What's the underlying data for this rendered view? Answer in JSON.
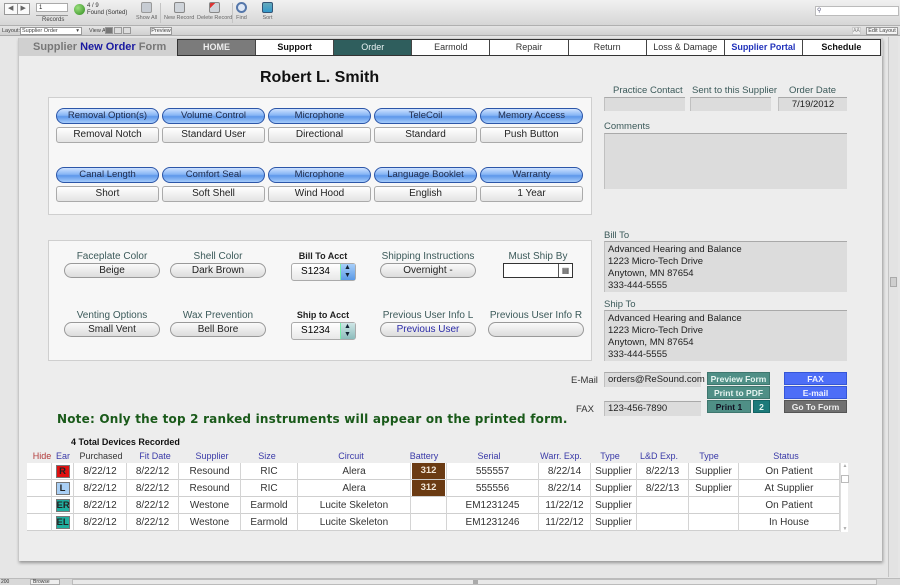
{
  "toolbar": {
    "record_number": "1",
    "records_label": "Records",
    "found_count": "4 / 9",
    "found_status": "Found (Sorted)",
    "buttons": {
      "show_all": "Show All",
      "new_record": "New Record",
      "delete_record": "Delete Record",
      "find": "Find",
      "sort": "Sort"
    },
    "search_placeholder": ""
  },
  "layoutbar": {
    "layout_label": "Layout:",
    "layout_value": "Supplier Order",
    "view_as_label": "View As:",
    "preview_label": "Preview",
    "aa_label": "AÄ",
    "edit_layout_label": "Edit Layout"
  },
  "form": {
    "title_part1": "Supplier ",
    "title_part2": "New Order",
    "title_part3": " Form",
    "nav_tabs": [
      "HOME",
      "Support",
      "Order",
      "Earmold",
      "Repair",
      "Return",
      "Loss & Damage",
      "Supplier Portal",
      "Schedule"
    ],
    "patient_name": "Robert L. Smith",
    "options": [
      {
        "label": "Removal Option(s)",
        "value": "Removal Notch"
      },
      {
        "label": "Volume Control",
        "value": "Standard User"
      },
      {
        "label": "Microphone",
        "value": "Directional"
      },
      {
        "label": "TeleCoil",
        "value": "Standard"
      },
      {
        "label": "Memory Access",
        "value": "Push Button"
      },
      {
        "label": "Canal Length",
        "value": "Short"
      },
      {
        "label": "Comfort Seal",
        "value": "Soft Shell"
      },
      {
        "label": "Microphone",
        "value": "Wind Hood"
      },
      {
        "label": "Language Booklet",
        "value": "English"
      },
      {
        "label": "Warranty",
        "value": "1 Year"
      }
    ],
    "details": {
      "faceplate_color": {
        "label": "Faceplate Color",
        "value": "Beige"
      },
      "shell_color": {
        "label": "Shell Color",
        "value": "Dark Brown"
      },
      "bill_to_acct": {
        "label": "Bill To Acct",
        "value": "S1234"
      },
      "shipping_instructions": {
        "label": "Shipping Instructions",
        "value": "Overnight -"
      },
      "must_ship_by": {
        "label": "Must Ship By",
        "value": ""
      },
      "venting_options": {
        "label": "Venting Options",
        "value": "Small Vent"
      },
      "wax_prevention": {
        "label": "Wax Prevention",
        "value": "Bell Bore"
      },
      "ship_to_acct": {
        "label": "Ship to Acct",
        "value": "S1234"
      },
      "prev_user_l": {
        "label": "Previous User Info L",
        "value": "Previous User"
      },
      "prev_user_r": {
        "label": "Previous User Info R",
        "value": ""
      }
    },
    "right": {
      "practice_contact_label": "Practice Contact",
      "practice_contact_value": "",
      "sent_supplier_label": "Sent to this Supplier",
      "sent_supplier_value": "",
      "order_date_label": "Order Date",
      "order_date_value": "7/19/2012",
      "comments_label": "Comments",
      "comments_value": "",
      "bill_to_label": "Bill To",
      "bill_to_value": "Advanced Hearing and Balance\n1223 Micro-Tech Drive\nAnytown, MN 87654\n333-444-5555",
      "ship_to_label": "Ship To",
      "ship_to_value": "Advanced Hearing and Balance\n1223 Micro-Tech Drive\nAnytown, MN 87654\n333-444-5555",
      "email_label": "E-Mail",
      "email_value": "orders@ReSound.com",
      "fax_label": "FAX",
      "fax_value": "123-456-7890"
    },
    "actions": {
      "preview_form": "Preview Form",
      "print_pdf": "Print to PDF",
      "print_1": "Print 1",
      "print_2": "2",
      "fax": "FAX",
      "email": "E-mail",
      "go_to_form": "Go To Form"
    },
    "note": "Note: Only the top 2 ranked instruments will appear on the printed form.",
    "total_devices": "4 Total Devices Recorded",
    "colors": {
      "accent_blue": "#4d6ef7",
      "teal": "#2f5e5d",
      "battery_brown": "#6b3b13",
      "note_green": "#1a5a1a"
    }
  },
  "devices": {
    "columns": [
      "Hide",
      "Ear",
      "Purchased",
      "Fit Date",
      "Supplier",
      "Size",
      "Circuit",
      "Battery",
      "Serial",
      "Warr. Exp.",
      "Type",
      "L&D  Exp.",
      "Type",
      "Status"
    ],
    "rows": [
      {
        "ear": "R",
        "ear_color": "#e01010",
        "purchased": "8/22/12",
        "fit": "8/22/12",
        "supplier": "Resound",
        "size": "RIC",
        "circuit": "Alera",
        "battery": "312",
        "serial": "555557",
        "warr": "8/22/14",
        "type": "Supplier",
        "ld": "8/22/13",
        "type2": "Supplier",
        "status": "On Patient"
      },
      {
        "ear": "L",
        "ear_color": "#a9cff5",
        "purchased": "8/22/12",
        "fit": "8/22/12",
        "supplier": "Resound",
        "size": "RIC",
        "circuit": "Alera",
        "battery": "312",
        "serial": "555556",
        "warr": "8/22/14",
        "type": "Supplier",
        "ld": "8/22/13",
        "type2": "Supplier",
        "status": "At Supplier"
      },
      {
        "ear": "ER",
        "ear_color": "#1fae9f",
        "purchased": "8/22/12",
        "fit": "8/22/12",
        "supplier": "Westone",
        "size": "Earmold",
        "circuit": "Lucite Skeleton",
        "battery": "",
        "serial": "EM1231245",
        "warr": "11/22/12",
        "type": "Supplier",
        "ld": "",
        "type2": "",
        "status": "On Patient"
      },
      {
        "ear": "EL",
        "ear_color": "#1fae9f",
        "purchased": "8/22/12",
        "fit": "8/22/12",
        "supplier": "Westone",
        "size": "Earmold",
        "circuit": "Lucite Skeleton",
        "battery": "",
        "serial": "EM1231246",
        "warr": "11/22/12",
        "type": "Supplier",
        "ld": "",
        "type2": "",
        "status": "In House"
      }
    ]
  },
  "statusbar": {
    "zoom": "200",
    "mode": "Browse"
  }
}
